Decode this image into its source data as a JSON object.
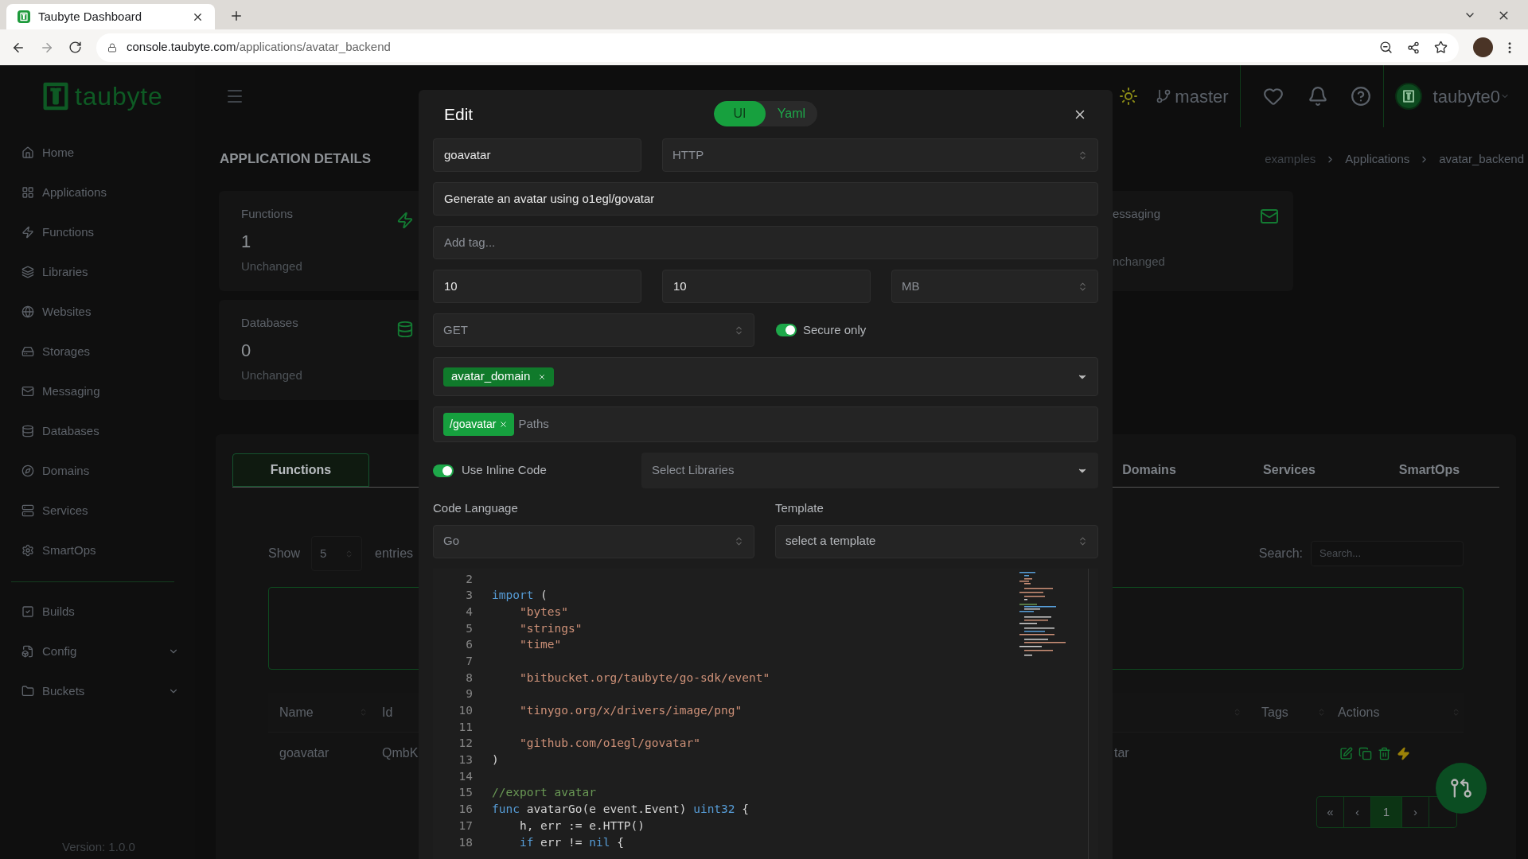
{
  "browser": {
    "tab": {
      "title": "Taubyte Dashboard"
    },
    "url": {
      "host": "console.taubyte.com",
      "path": "/applications/avatar_backend"
    }
  },
  "sidebar": {
    "logo": "taubyte",
    "items": [
      {
        "label": "Home"
      },
      {
        "label": "Applications"
      },
      {
        "label": "Functions"
      },
      {
        "label": "Libraries"
      },
      {
        "label": "Websites"
      },
      {
        "label": "Storages"
      },
      {
        "label": "Messaging"
      },
      {
        "label": "Databases"
      },
      {
        "label": "Domains"
      },
      {
        "label": "Services"
      },
      {
        "label": "SmartOps"
      }
    ],
    "items_2": [
      {
        "label": "Builds",
        "expandable": false
      },
      {
        "label": "Config",
        "expandable": true
      },
      {
        "label": "Buckets",
        "expandable": true
      }
    ],
    "version": "Version: 1.0.0"
  },
  "header": {
    "branch": "master",
    "user": "taubyte0"
  },
  "page": {
    "title": "APPLICATION DETAILS",
    "breadcrumb": [
      "examples",
      "Applications",
      "avatar_backend"
    ],
    "stats": [
      {
        "label": "Functions",
        "count": "1",
        "status": "Unchanged"
      },
      {
        "label": "Databases",
        "count": "0",
        "status": "Unchanged"
      },
      {
        "label": "essaging",
        "status": "nchanged"
      }
    ],
    "tabs": [
      {
        "label": "Functions",
        "selected": true
      },
      {
        "label": "Domains",
        "selected": false
      },
      {
        "label": "Services",
        "selected": false
      },
      {
        "label": "SmartOps",
        "selected": false
      }
    ],
    "show_label": "Show",
    "page_size": "5",
    "entries_label": "entries",
    "search_label": "Search:",
    "search_placeholder": "Search...",
    "columns": [
      "Name",
      "Id",
      "Tags",
      "Actions"
    ],
    "rows": [
      {
        "cells": [
          "goavatar",
          "QmbK",
          "tar"
        ]
      }
    ],
    "pagination": [
      {
        "label": "«",
        "selected": false
      },
      {
        "label": "‹",
        "selected": false
      },
      {
        "label": "1",
        "selected": true
      },
      {
        "label": "›",
        "selected": false
      }
    ]
  },
  "modal": {
    "title": "Edit",
    "modes": [
      {
        "label": "UI",
        "selected": true
      },
      {
        "label": "Yaml",
        "selected": false
      }
    ],
    "name": "goavatar",
    "type": "HTTP",
    "description": "Generate an avatar using o1egl/govatar",
    "tags_placeholder": "Add tag...",
    "timeout": "10",
    "memory": "10",
    "memory_unit": "MB",
    "method": "GET",
    "secure": {
      "label": "Secure only",
      "on": true
    },
    "domains": [
      {
        "label": "avatar_domain"
      }
    ],
    "paths": {
      "values": [
        "/goavatar"
      ],
      "placeholder": "Paths"
    },
    "inline": {
      "label": "Use Inline Code",
      "on": true
    },
    "libraries_placeholder": "Select Libraries",
    "language": {
      "label": "Code Language",
      "value": "Go"
    },
    "template": {
      "label": "Template",
      "placeholder": "select a template"
    },
    "code": [
      {
        "number": "2"
      },
      {
        "number": "3",
        "tokens": [
          {
            "text": "import",
            "kind": "keyword"
          },
          {
            "text": " (",
            "kind": "plain"
          }
        ]
      },
      {
        "number": "4",
        "tokens": [
          {
            "text": "    \"bytes\"",
            "kind": "string"
          }
        ]
      },
      {
        "number": "5",
        "tokens": [
          {
            "text": "    \"strings\"",
            "kind": "string"
          }
        ]
      },
      {
        "number": "6",
        "tokens": [
          {
            "text": "    \"time\"",
            "kind": "string"
          }
        ]
      },
      {
        "number": "7"
      },
      {
        "number": "8",
        "tokens": [
          {
            "text": "    \"bitbucket.org/taubyte/go-sdk/event\"",
            "kind": "string"
          }
        ]
      },
      {
        "number": "9"
      },
      {
        "number": "10",
        "tokens": [
          {
            "text": "    \"tinygo.org/x/drivers/image/png\"",
            "kind": "string"
          }
        ]
      },
      {
        "number": "11"
      },
      {
        "number": "12",
        "tokens": [
          {
            "text": "    \"github.com/o1egl/govatar\"",
            "kind": "string"
          }
        ]
      },
      {
        "number": "13",
        "tokens": [
          {
            "text": ")",
            "kind": "plain"
          }
        ]
      },
      {
        "number": "14"
      },
      {
        "number": "15",
        "tokens": [
          {
            "text": "//export avatar",
            "kind": "comment"
          }
        ]
      },
      {
        "number": "16",
        "tokens": [
          {
            "text": "func",
            "kind": "keyword"
          },
          {
            "text": " avatarGo(e event.Event) ",
            "kind": "plain"
          },
          {
            "text": "uint32",
            "kind": "keyword"
          },
          {
            "text": " {",
            "kind": "plain"
          }
        ]
      },
      {
        "number": "17",
        "tokens": [
          {
            "text": "    h, err := e.HTTP()",
            "kind": "plain"
          }
        ]
      },
      {
        "number": "18",
        "tokens": [
          {
            "text": "    if",
            "kind": "keyword"
          },
          {
            "text": " err != ",
            "kind": "plain"
          },
          {
            "text": "nil",
            "kind": "keyword"
          },
          {
            "text": " {",
            "kind": "plain"
          }
        ]
      }
    ]
  }
}
